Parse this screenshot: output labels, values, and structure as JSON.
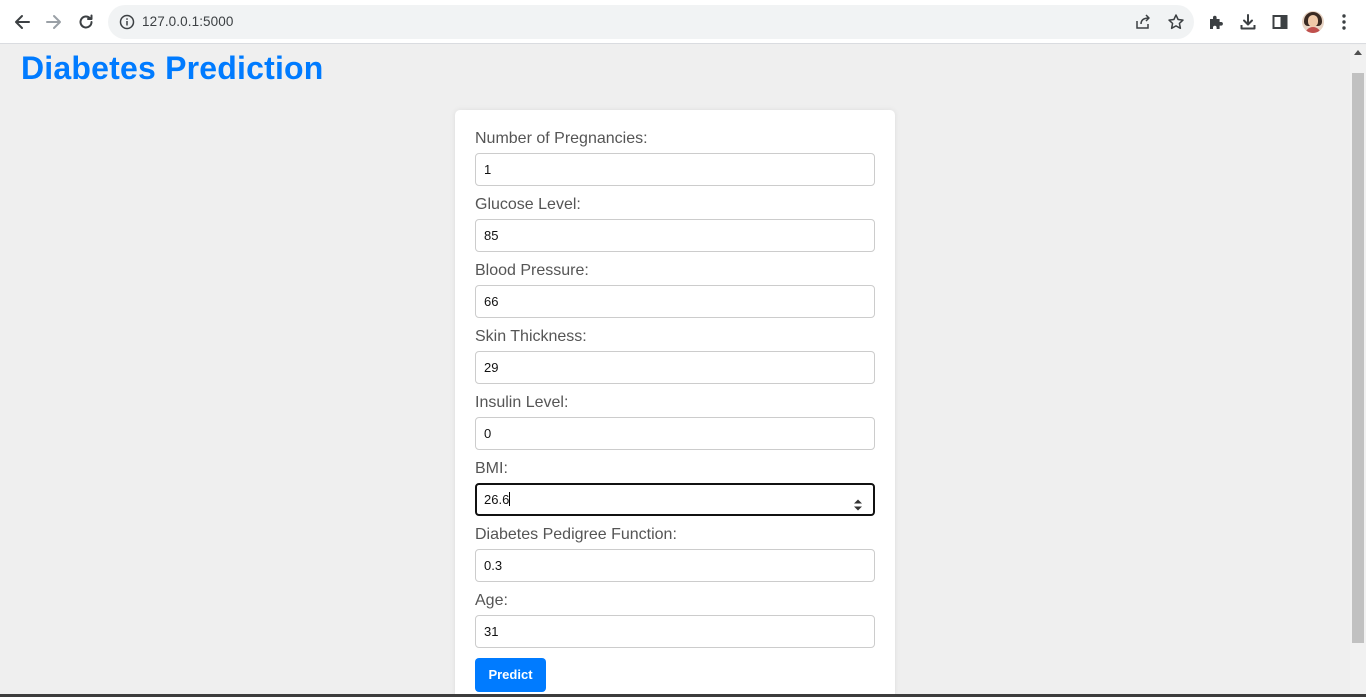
{
  "browser": {
    "url": "127.0.0.1:5000",
    "icons": [
      "back-arrow-icon",
      "forward-arrow-icon",
      "reload-icon",
      "info-icon",
      "share-icon",
      "bookmark-star-icon",
      "extensions-puzzle-icon",
      "download-icon",
      "side-panel-icon",
      "profile-avatar",
      "kebab-menu-icon"
    ]
  },
  "page": {
    "title": "Diabetes Prediction",
    "accent_color": "#007bff"
  },
  "form": {
    "fields": [
      {
        "label": "Number of Pregnancies:",
        "value": "1"
      },
      {
        "label": "Glucose Level:",
        "value": "85"
      },
      {
        "label": "Blood Pressure:",
        "value": "66"
      },
      {
        "label": "Skin Thickness:",
        "value": "29"
      },
      {
        "label": "Insulin Level:",
        "value": "0"
      },
      {
        "label": "BMI:",
        "value": "26.6"
      },
      {
        "label": "Diabetes Pedigree Function:",
        "value": "0.3"
      },
      {
        "label": "Age:",
        "value": "31"
      }
    ],
    "submit_label": "Predict"
  }
}
